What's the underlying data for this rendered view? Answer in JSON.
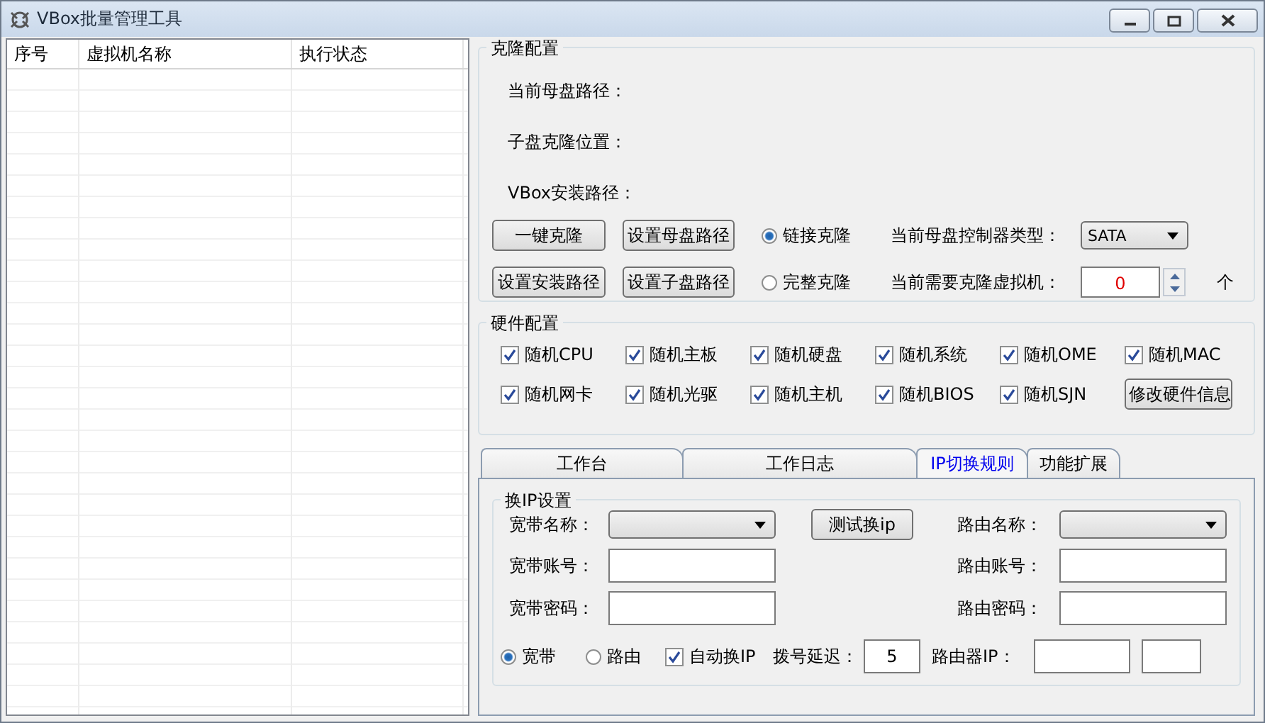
{
  "window": {
    "title": "VBox批量管理工具"
  },
  "table": {
    "columns": [
      "序号",
      "虚拟机名称",
      "执行状态"
    ]
  },
  "clone_config": {
    "title": "克隆配置",
    "path_labels": [
      "当前母盘路径：",
      "子盘克隆位置：",
      "VBox安装路径："
    ],
    "buttons": [
      "一键克隆",
      "设置母盘路径",
      "设置安装路径",
      "设置子盘路径"
    ],
    "modes": [
      {
        "label": "链接克隆",
        "selected": true
      },
      {
        "label": "完整克隆",
        "selected": false
      }
    ],
    "controller": {
      "label": "当前母盘控制器类型：",
      "value": "SATA"
    },
    "count": {
      "label": "当前需要克隆虚拟机：",
      "value": "0",
      "unit": "个"
    }
  },
  "hardware": {
    "title": "硬件配置",
    "options": [
      {
        "label": "随机CPU",
        "checked": true
      },
      {
        "label": "随机主板",
        "checked": true
      },
      {
        "label": "随机硬盘",
        "checked": true
      },
      {
        "label": "随机系统",
        "checked": true
      },
      {
        "label": "随机OME",
        "checked": true
      },
      {
        "label": "随机MAC",
        "checked": true
      },
      {
        "label": "随机网卡",
        "checked": true
      },
      {
        "label": "随机光驱",
        "checked": true
      },
      {
        "label": "随机主机",
        "checked": true
      },
      {
        "label": "随机BIOS",
        "checked": true
      },
      {
        "label": "随机SJN",
        "checked": true
      }
    ],
    "button": "修改硬件信息"
  },
  "tabs": [
    {
      "label": "工作台",
      "selected": false
    },
    {
      "label": "工作日志",
      "selected": false
    },
    {
      "label": "IP切换规则",
      "selected": true
    },
    {
      "label": "功能扩展",
      "selected": false
    }
  ],
  "ip_settings": {
    "title": "换IP设置",
    "broadband_name": {
      "label": "宽带名称："
    },
    "broadband_account": {
      "label": "宽带账号："
    },
    "broadband_password": {
      "label": "宽带密码："
    },
    "test_button": "测试换ip",
    "router_name": {
      "label": "路由名称："
    },
    "router_account": {
      "label": "路由账号："
    },
    "router_password": {
      "label": "路由密码："
    },
    "modes": [
      {
        "label": "宽带",
        "selected": true
      },
      {
        "label": "路由",
        "selected": false
      }
    ],
    "auto_switch": {
      "label": "自动换IP",
      "checked": true
    },
    "dial_delay": {
      "label": "拨号延迟：",
      "value": "5"
    },
    "router_ip": {
      "label": "路由器IP："
    }
  }
}
